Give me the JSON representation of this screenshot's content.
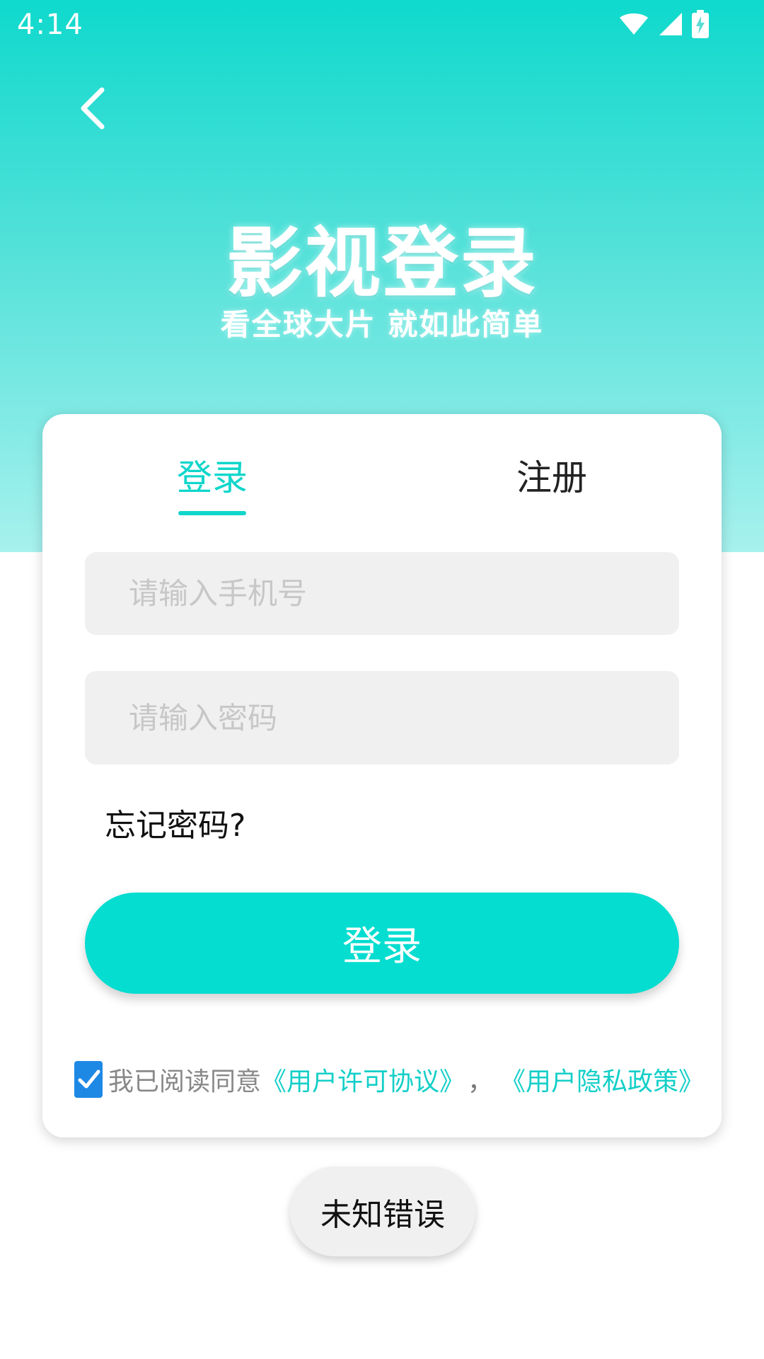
{
  "status_bar": {
    "time": "4:14",
    "icons": [
      "wifi-icon",
      "signal-icon",
      "battery-charging-icon"
    ]
  },
  "header": {
    "back_icon": "chevron-left-icon",
    "title": "影视登录",
    "subtitle": "看全球大片 就如此简单"
  },
  "tabs": [
    {
      "label": "登录",
      "active": true
    },
    {
      "label": "注册",
      "active": false
    }
  ],
  "form": {
    "phone_placeholder": "请输入手机号",
    "password_placeholder": "请输入密码",
    "forgot_password": "忘记密码?",
    "login_button": "登录"
  },
  "agreement": {
    "checked": true,
    "prefix": "我已阅读同意",
    "user_license": "《用户许可协议》",
    "separator": "，",
    "privacy_policy": "《用户隐私政策》"
  },
  "toast": {
    "message": "未知错误"
  },
  "colors": {
    "accent": "#04ddd0",
    "link": "#14cfc8",
    "checkbox": "#1e88e5",
    "hero_top": "#0fd9cd",
    "hero_bottom": "#a7f1ee"
  }
}
